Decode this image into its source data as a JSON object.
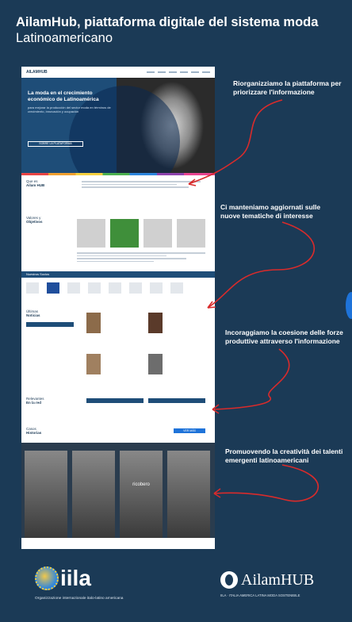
{
  "title": {
    "line1": "AilamHub, piattaforma digitale del sistema moda",
    "line2": "Latinoamericano"
  },
  "site": {
    "logo": "AILAMHUB",
    "hero_heading": "La moda en el crecimiento económico de Latinoamérica",
    "hero_sub": "para mejorar la producción del sector moda en términos de crecimiento, innovación y ocupación",
    "hero_button": "SOBRE LA PLATAFORMA",
    "section_que_es": "Que es",
    "section_que_es_bold": "Ailam HUB",
    "section_valores": "Valores y",
    "section_valores_bold": "Objetivos",
    "partners_bar": "Nuestros Socios",
    "partner_cdu": "CDU",
    "section_ultimas": "Últimas",
    "section_ultimas_bold": "Noticias",
    "section_relevantes": "Relevantes",
    "section_relevantes_bold": "En la red",
    "section_casos": "Casos",
    "section_casos_bold": "Historias",
    "casos_button": "VER MÁS",
    "bw_label": "ricobero"
  },
  "captions": {
    "c1": "Riorganizziamo la piattaforma per priorizzare  l'informazione",
    "c2": "Ci manteniamo aggiornati sulle nuove tematiche di interesse",
    "c3": "Incoraggiamo la coesione delle forze produttive attraverso l'informazione",
    "c4": "Promuovendo la creatività dei talenti emergenti latinoamericani"
  },
  "footer": {
    "iila_word": "iila",
    "iila_sub": "Organizzazione internazionale italo-latino americana",
    "ailam_word": "AilamHUB",
    "ailam_sub": "IILA · ITALIA AMERICA LATINA MODA SOSTENIBILE"
  },
  "colors": {
    "background": "#1b3a56",
    "arrow": "#d92b2b",
    "accent_blue": "#1e73d9"
  }
}
